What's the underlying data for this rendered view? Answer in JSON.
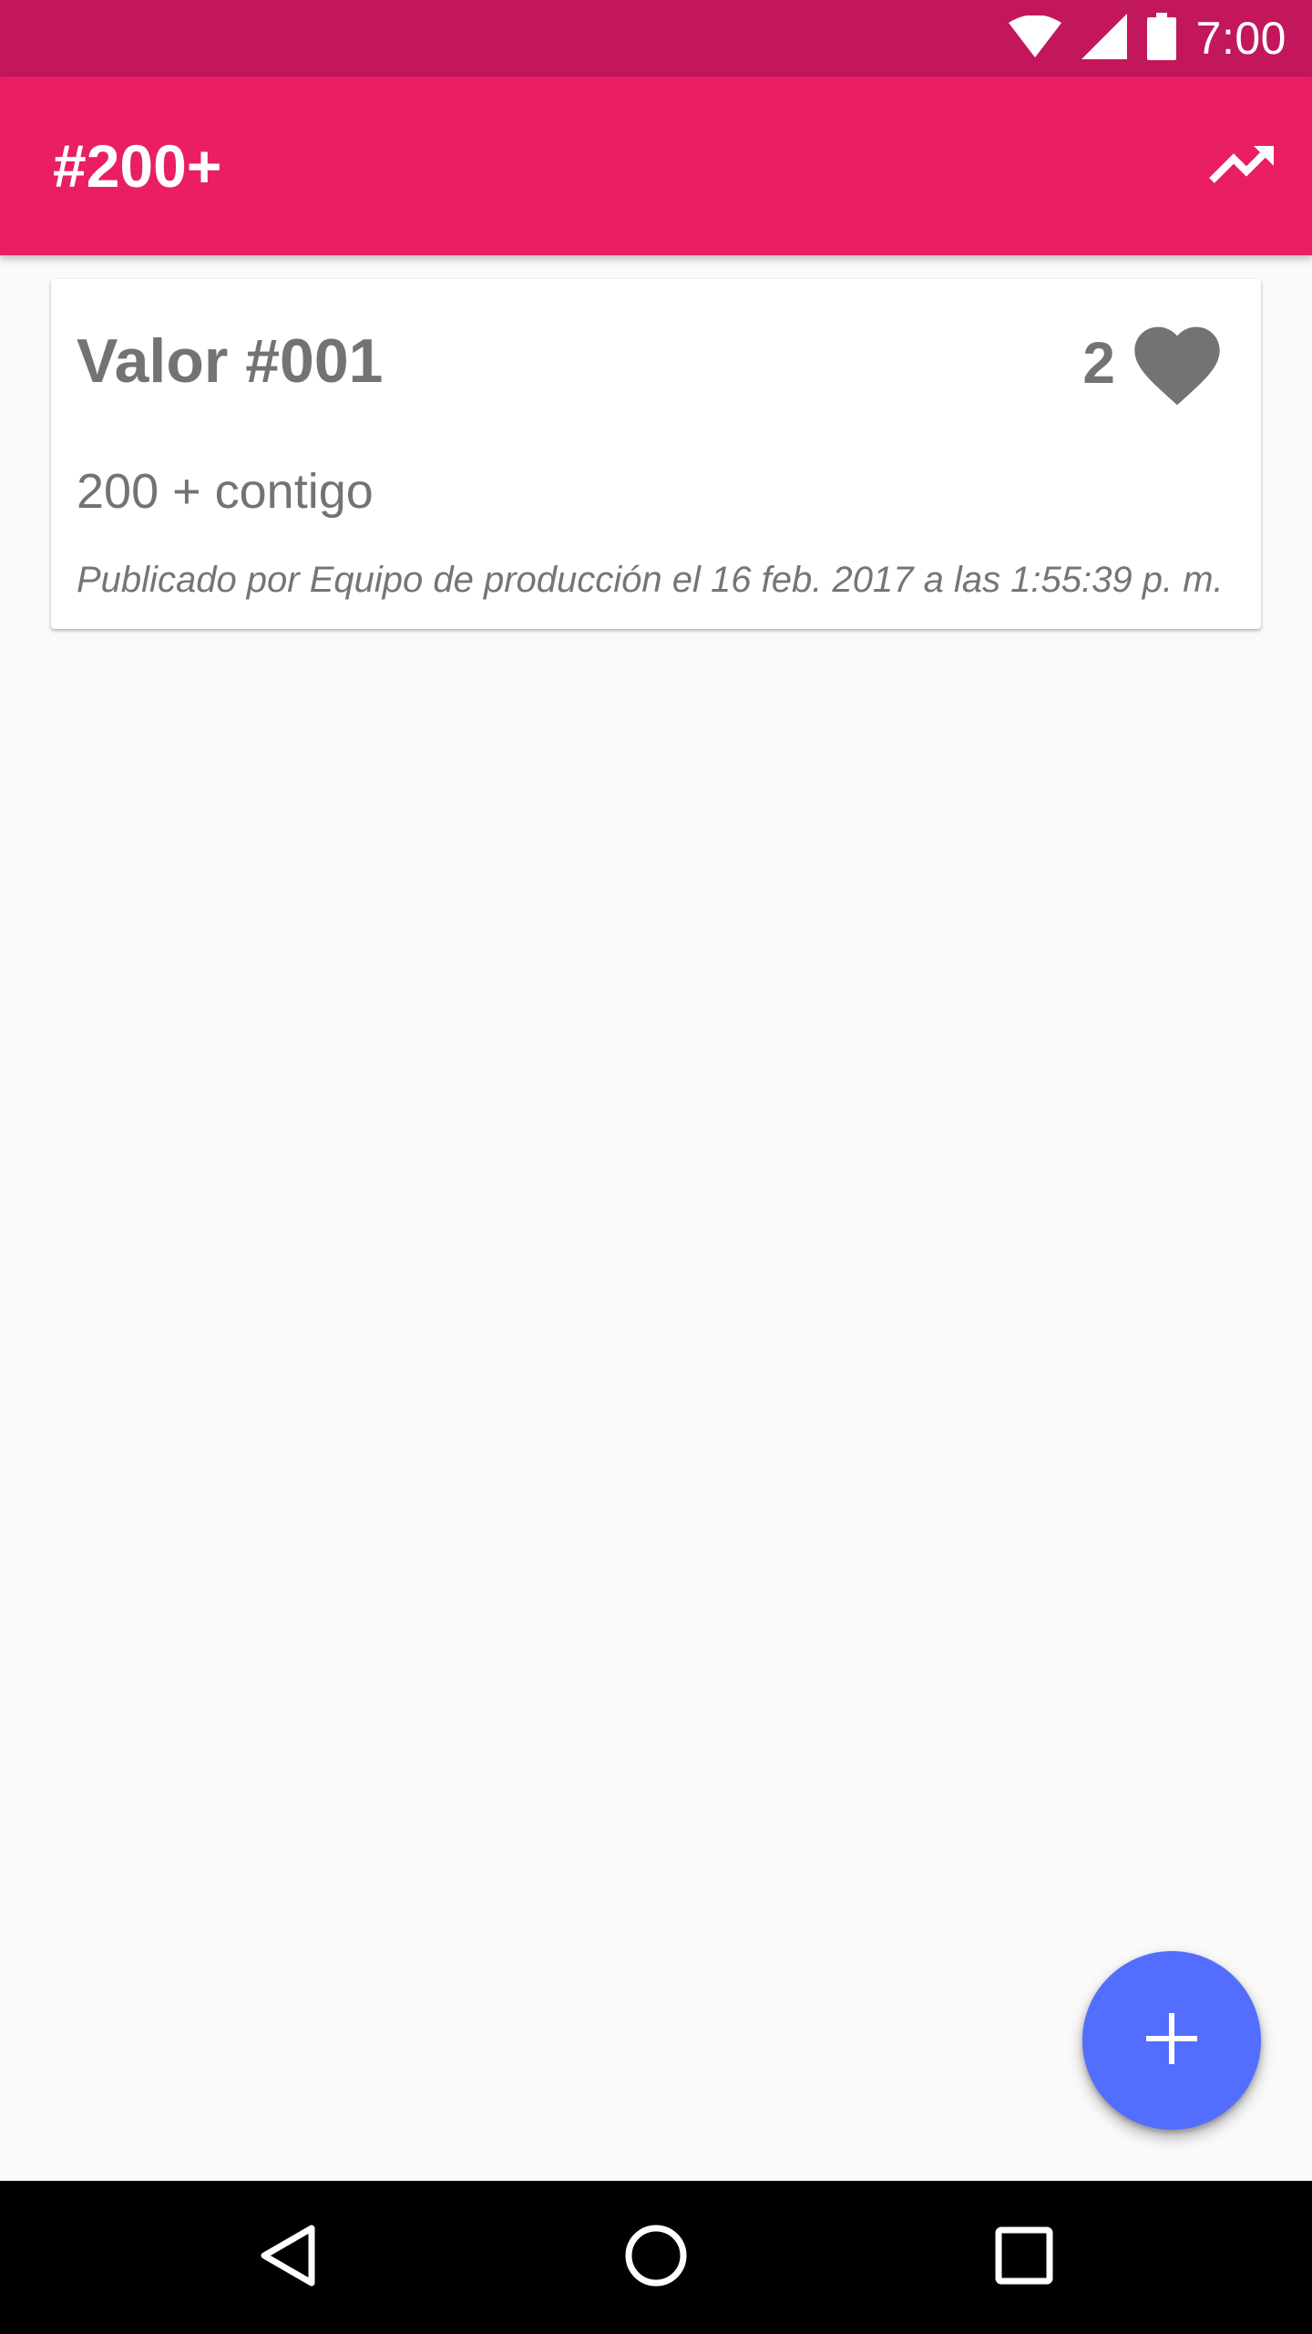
{
  "status_bar": {
    "time": "7:00",
    "icons": [
      "wifi-icon",
      "signal-icon",
      "battery-icon"
    ]
  },
  "app_bar": {
    "title": "#200+",
    "action_icon": "trending-up-icon"
  },
  "cards": [
    {
      "title": "Valor #001",
      "likes": "2",
      "text": "200 + contigo",
      "meta": "Publicado por Equipo de producción el 16 feb. 2017 a las 1:55:39 p. m."
    }
  ],
  "fab": {
    "icon": "plus-icon"
  },
  "nav_bar": {
    "buttons": [
      "back-icon",
      "home-icon",
      "recents-icon"
    ]
  },
  "colors": {
    "status_bar": "#c2185b",
    "app_bar": "#e91e63",
    "fab": "#536dfe",
    "card_text": "#737373",
    "background": "#fafafa"
  }
}
